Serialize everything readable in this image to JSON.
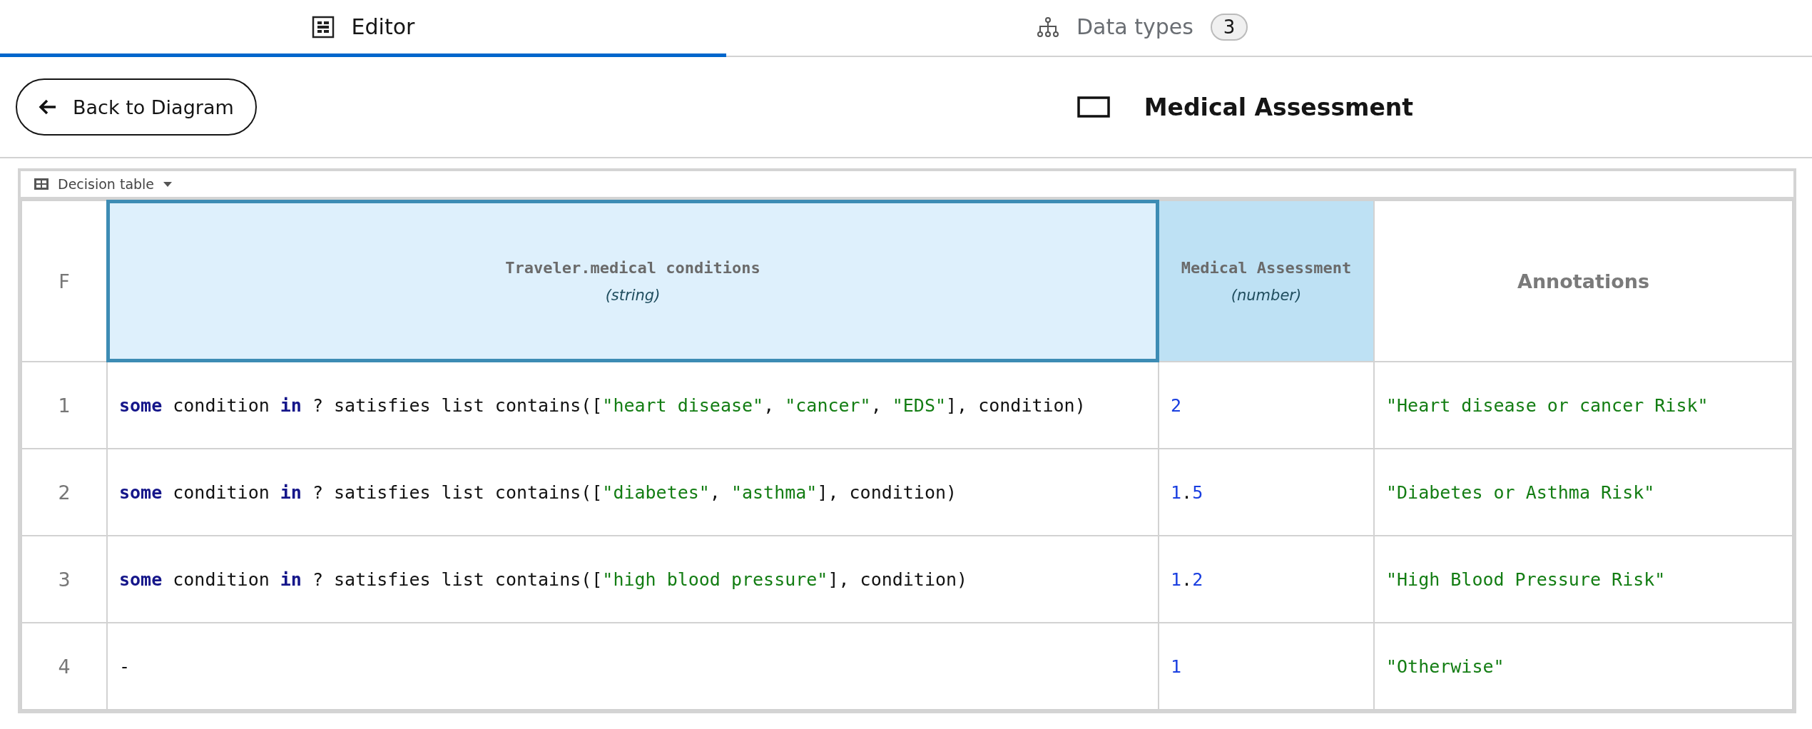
{
  "tabs": [
    {
      "label": "Editor",
      "kind": "editor",
      "selected": true
    },
    {
      "label": "Data types",
      "kind": "types",
      "badge": "3",
      "selected": false
    }
  ],
  "back_button": {
    "label": "Back to Diagram"
  },
  "title": "Medical Assessment",
  "table": {
    "toolbar": {
      "label": "Decision table"
    },
    "hit_policy": "F",
    "columns": [
      {
        "kind": "input",
        "name": "Traveler.medical conditions",
        "type": "(string)",
        "selected": true
      },
      {
        "kind": "output",
        "name": "Medical Assessment",
        "type": "(number)",
        "selected": false
      },
      {
        "kind": "annotation",
        "name": "Annotations",
        "selected": false
      }
    ],
    "rows": [
      {
        "number": "1",
        "cells": [
          [
            {
              "kind": "keyword",
              "text": "some"
            },
            {
              "kind": "plain",
              "text": " condition "
            },
            {
              "kind": "keyword",
              "text": "in"
            },
            {
              "kind": "plain",
              "text": " ? satisfies list contains(["
            },
            {
              "kind": "string",
              "text": "\"heart disease\""
            },
            {
              "kind": "plain",
              "text": ", "
            },
            {
              "kind": "string",
              "text": "\"cancer\""
            },
            {
              "kind": "plain",
              "text": ", "
            },
            {
              "kind": "string",
              "text": "\"EDS\""
            },
            {
              "kind": "plain",
              "text": "], condition)"
            }
          ],
          [
            {
              "kind": "number",
              "text": "2"
            }
          ],
          [
            {
              "kind": "string",
              "text": "\"Heart disease or cancer Risk\""
            }
          ]
        ]
      },
      {
        "number": "2",
        "cells": [
          [
            {
              "kind": "keyword",
              "text": "some"
            },
            {
              "kind": "plain",
              "text": " condition "
            },
            {
              "kind": "keyword",
              "text": "in"
            },
            {
              "kind": "plain",
              "text": " ? satisfies list contains(["
            },
            {
              "kind": "string",
              "text": "\"diabetes\""
            },
            {
              "kind": "plain",
              "text": ", "
            },
            {
              "kind": "string",
              "text": "\"asthma\""
            },
            {
              "kind": "plain",
              "text": "], condition)"
            }
          ],
          [
            {
              "kind": "number",
              "text": "1"
            },
            {
              "kind": "plain",
              "text": "."
            },
            {
              "kind": "number",
              "text": "5"
            }
          ],
          [
            {
              "kind": "string",
              "text": "\"Diabetes or Asthma Risk\""
            }
          ]
        ]
      },
      {
        "number": "3",
        "cells": [
          [
            {
              "kind": "keyword",
              "text": "some"
            },
            {
              "kind": "plain",
              "text": " condition "
            },
            {
              "kind": "keyword",
              "text": "in"
            },
            {
              "kind": "plain",
              "text": " ? satisfies list contains(["
            },
            {
              "kind": "string",
              "text": "\"high blood pressure\""
            },
            {
              "kind": "plain",
              "text": "], condition)"
            }
          ],
          [
            {
              "kind": "number",
              "text": "1"
            },
            {
              "kind": "plain",
              "text": "."
            },
            {
              "kind": "number",
              "text": "2"
            }
          ],
          [
            {
              "kind": "string",
              "text": "\"High Blood Pressure Risk\""
            }
          ]
        ]
      },
      {
        "number": "4",
        "cells": [
          [
            {
              "kind": "plain",
              "text": "-"
            }
          ],
          [
            {
              "kind": "number",
              "text": "1"
            }
          ],
          [
            {
              "kind": "string",
              "text": "\"Otherwise\""
            }
          ]
        ]
      }
    ]
  }
}
